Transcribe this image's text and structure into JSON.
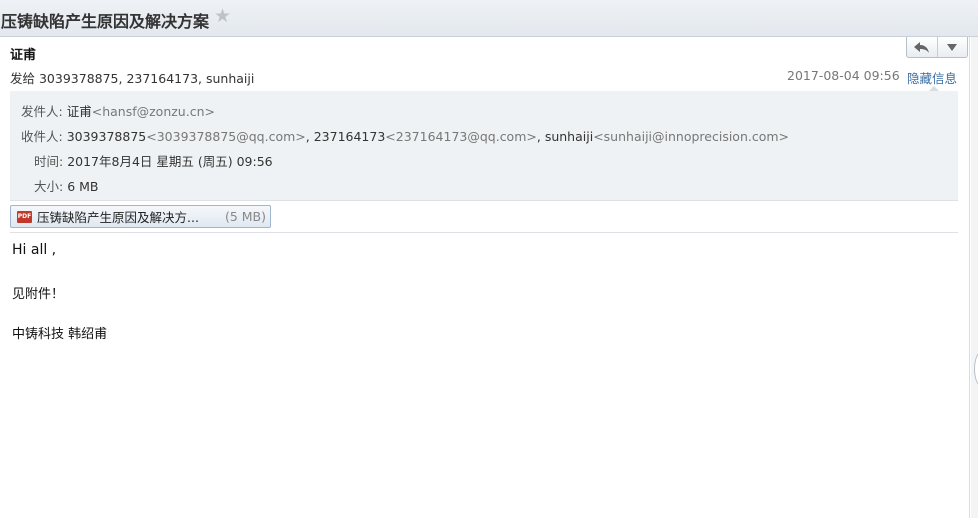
{
  "email": {
    "subject": "压铸缺陷产生原因及解决方案",
    "star_icon": "star-icon",
    "toolbar": {
      "reply_icon": "reply-icon",
      "more_icon": "dropdown-icon"
    },
    "sender_display": "证甫",
    "to_summary": "发给 3039378875, 237164173, sunhaiji",
    "date_short": "2017-08-04 09:56",
    "hide_details": "隐藏信息",
    "details": {
      "from_label": "发件人:",
      "from_name": "证甫",
      "from_addr": "<hansf@zonzu.cn>",
      "to_label": "收件人:",
      "to": [
        {
          "name": "3039378875",
          "addr": "<3039378875@qq.com>",
          "sep": ","
        },
        {
          "name": "237164173",
          "addr": "<237164173@qq.com>",
          "sep": ","
        },
        {
          "name": "sunhaiji",
          "addr": "<sunhaiji@innoprecision.com>",
          "sep": ""
        }
      ],
      "time_label": "时间:",
      "time_value": "2017年8月4日 星期五 (周五) 09:56",
      "size_label": "大小:",
      "size_value": "6 MB"
    },
    "attachment": {
      "icon": "pdf-icon",
      "icon_text": "PDF",
      "name": "压铸缺陷产生原因及解决方...",
      "size": "(5 MB)"
    },
    "body": {
      "greeting": "Hi all ,",
      "line1": "见附件！",
      "signature": "中铸科技 韩绍甫"
    }
  }
}
